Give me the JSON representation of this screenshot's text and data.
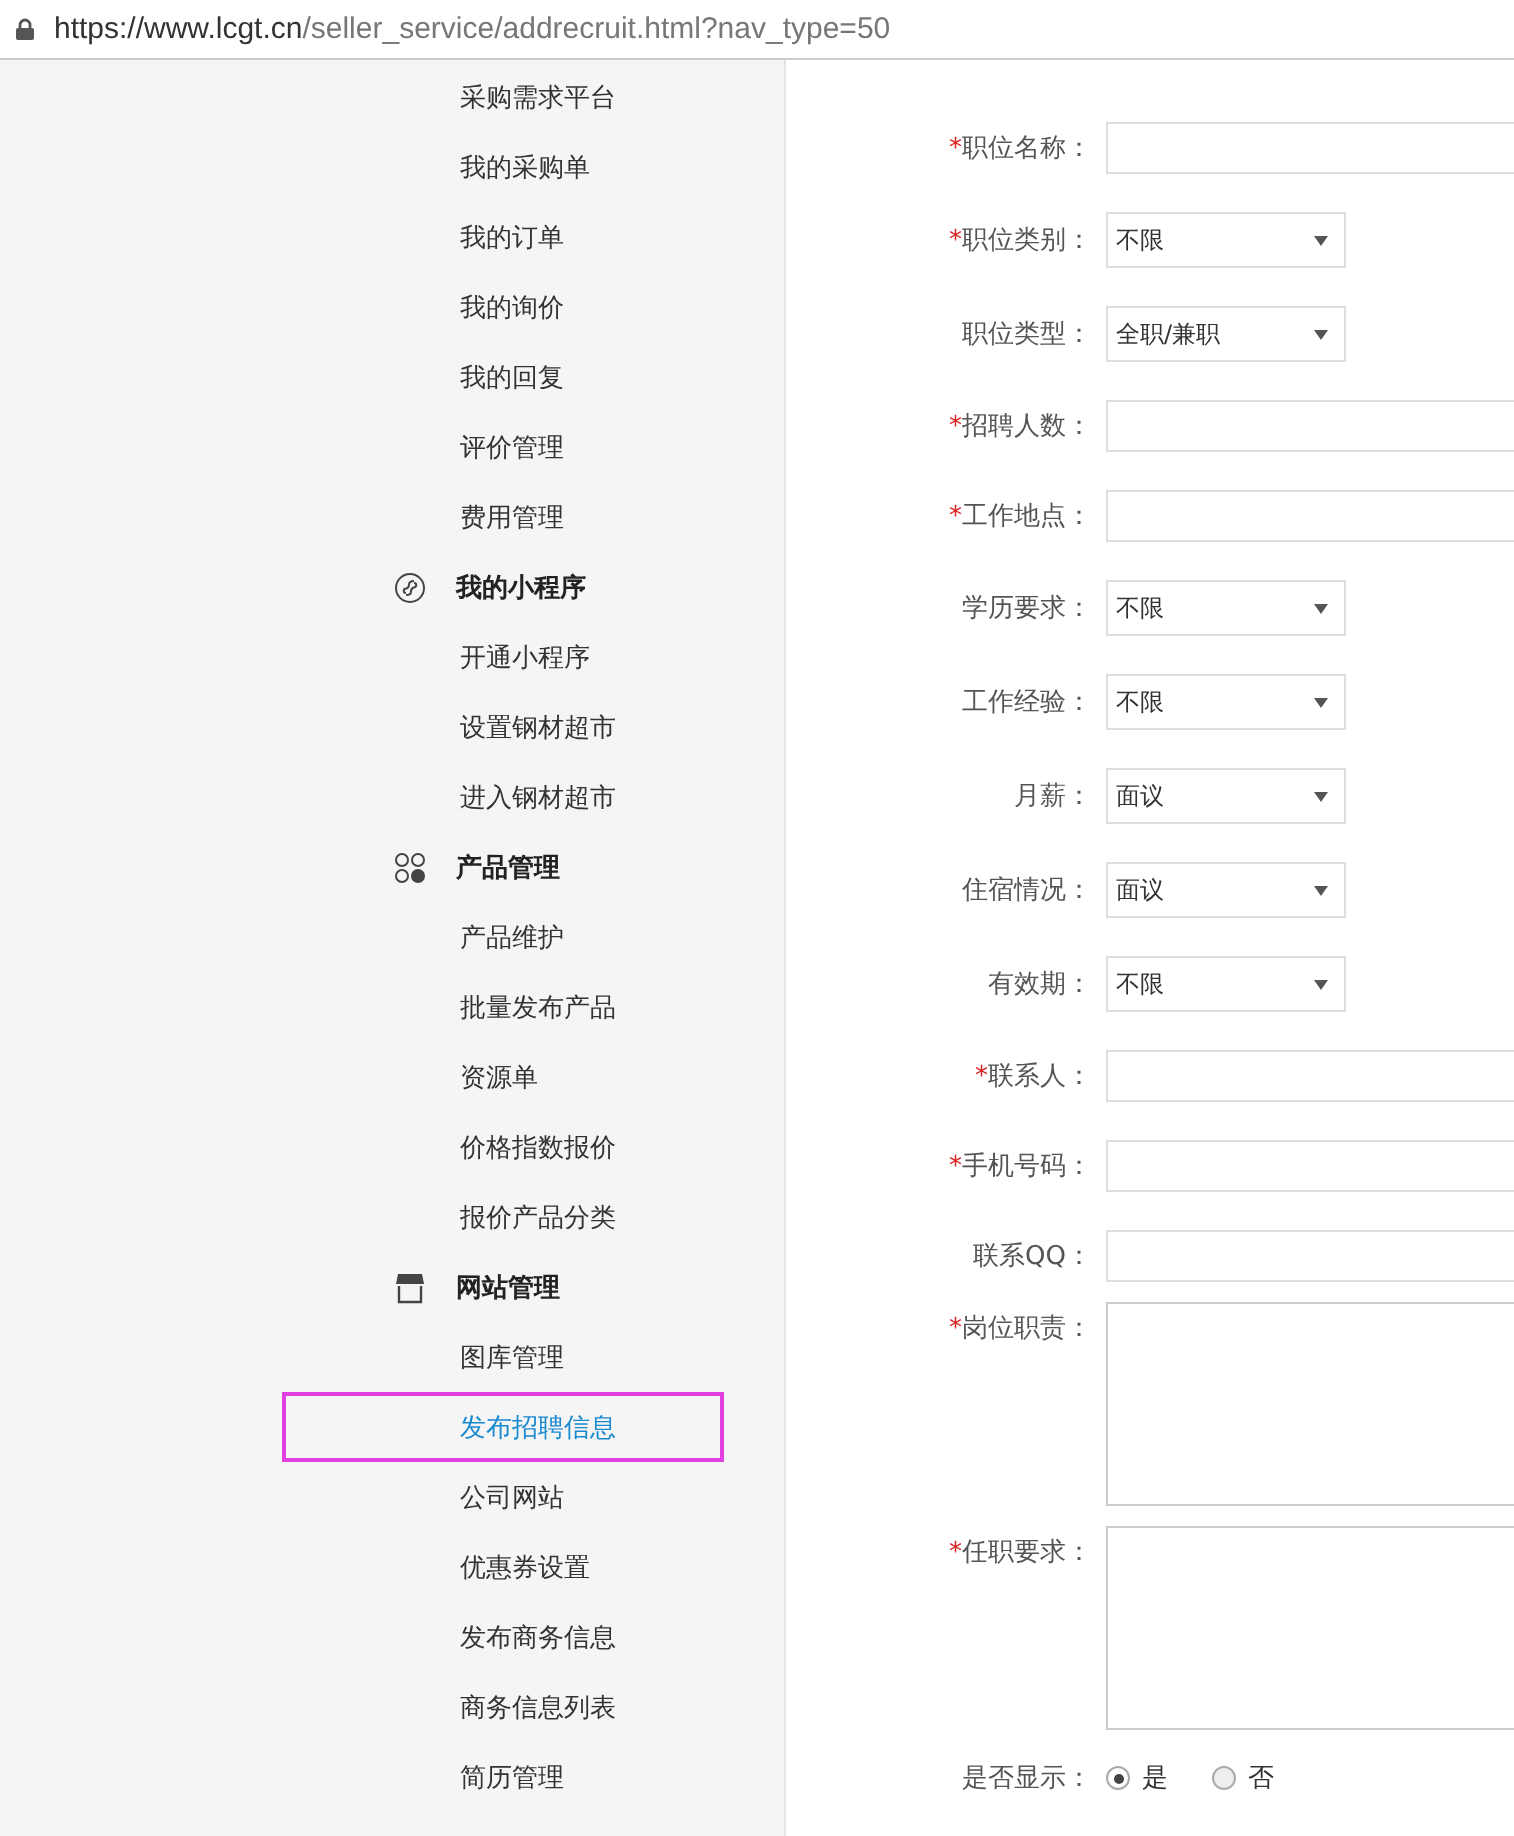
{
  "address_bar": {
    "host": "https://www.lcgt.cn",
    "path": "/seller_service/addrecruit.html?nav_type=50"
  },
  "sidebar": {
    "items": [
      {
        "kind": "item",
        "label": "采购需求平台",
        "selected": false
      },
      {
        "kind": "item",
        "label": "我的采购单",
        "selected": false
      },
      {
        "kind": "item",
        "label": "我的订单",
        "selected": false
      },
      {
        "kind": "item",
        "label": "我的询价",
        "selected": false
      },
      {
        "kind": "item",
        "label": "我的回复",
        "selected": false
      },
      {
        "kind": "item",
        "label": "评价管理",
        "selected": false
      },
      {
        "kind": "item",
        "label": "费用管理",
        "selected": false
      },
      {
        "kind": "group",
        "label": "我的小程序"
      },
      {
        "kind": "item",
        "label": "开通小程序",
        "selected": false
      },
      {
        "kind": "item",
        "label": "设置钢材超市",
        "selected": false
      },
      {
        "kind": "item",
        "label": "进入钢材超市",
        "selected": false
      },
      {
        "kind": "group",
        "label": "产品管理"
      },
      {
        "kind": "item",
        "label": "产品维护",
        "selected": false
      },
      {
        "kind": "item",
        "label": "批量发布产品",
        "selected": false
      },
      {
        "kind": "item",
        "label": "资源单",
        "selected": false
      },
      {
        "kind": "item",
        "label": "价格指数报价",
        "selected": false
      },
      {
        "kind": "item",
        "label": "报价产品分类",
        "selected": false
      },
      {
        "kind": "group",
        "label": "网站管理"
      },
      {
        "kind": "item",
        "label": "图库管理",
        "selected": false
      },
      {
        "kind": "item",
        "label": "发布招聘信息",
        "selected": true
      },
      {
        "kind": "item",
        "label": "公司网站",
        "selected": false
      },
      {
        "kind": "item",
        "label": "优惠券设置",
        "selected": false
      },
      {
        "kind": "item",
        "label": "发布商务信息",
        "selected": false
      },
      {
        "kind": "item",
        "label": "商务信息列表",
        "selected": false
      },
      {
        "kind": "item",
        "label": "简历管理",
        "selected": false
      }
    ]
  },
  "form": {
    "fields": [
      {
        "kind": "text",
        "required_mark": "*",
        "label": "职位名称："
      },
      {
        "kind": "select",
        "required_mark": "*",
        "label": "职位类别：",
        "value": "不限"
      },
      {
        "kind": "select",
        "label": "职位类型：",
        "value": "全职/兼职"
      },
      {
        "kind": "text",
        "required_mark": "*",
        "label": "招聘人数："
      },
      {
        "kind": "text",
        "required_mark": "*",
        "label": "工作地点："
      },
      {
        "kind": "select",
        "label": "学历要求：",
        "value": "不限"
      },
      {
        "kind": "select",
        "label": "工作经验：",
        "value": "不限"
      },
      {
        "kind": "select",
        "label": "月薪：",
        "value": "面议"
      },
      {
        "kind": "select",
        "label": "住宿情况：",
        "value": "面议"
      },
      {
        "kind": "select",
        "label": "有效期：",
        "value": "不限"
      },
      {
        "kind": "text",
        "required_mark": "*",
        "label": "联系人："
      },
      {
        "kind": "text",
        "required_mark": "*",
        "label": "手机号码："
      },
      {
        "kind": "text",
        "label": "联系QQ："
      },
      {
        "kind": "textarea",
        "required_mark": "*",
        "label": "岗位职责："
      },
      {
        "kind": "textarea",
        "required_mark": "*",
        "label": "任职要求："
      },
      {
        "kind": "radio",
        "label": "是否显示：",
        "options": [
          {
            "label": "是",
            "selected": true
          },
          {
            "label": "否",
            "selected": false
          }
        ]
      }
    ]
  }
}
